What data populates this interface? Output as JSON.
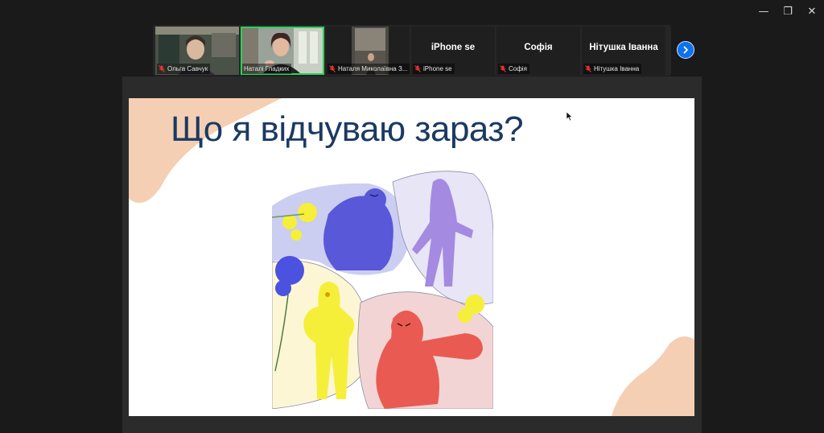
{
  "window": {
    "controls": [
      {
        "name": "minimize",
        "glyph": "—"
      },
      {
        "name": "restore",
        "glyph": "❐"
      },
      {
        "name": "close",
        "glyph": "✕"
      }
    ]
  },
  "participants": [
    {
      "name": "Ольга Савчук",
      "label": "Ольга Савчук",
      "video": true,
      "active": false,
      "muted": true
    },
    {
      "name": "Наталі Гладких",
      "label": "Наталі Гладких",
      "video": true,
      "active": true,
      "muted": false
    },
    {
      "name": "Наталя Миколаївна З...",
      "label": "Наталя Миколаївна З...",
      "video": true,
      "active": false,
      "muted": true
    },
    {
      "name": "iPhone se",
      "label": "iPhone se",
      "video": false,
      "active": false,
      "muted": true
    },
    {
      "name": "Софія",
      "label": "Софія",
      "video": false,
      "active": false,
      "muted": true
    },
    {
      "name": "Нітушка Іванна",
      "label": "Нітушка Іванна",
      "video": false,
      "active": false,
      "muted": true
    }
  ],
  "slide": {
    "title": "Що я відчуваю зараз?"
  },
  "colors": {
    "title": "#1b3a63",
    "accent_peach": "#f5cfb3",
    "active_border": "#2fd05a",
    "next_button": "#0e72ed"
  }
}
